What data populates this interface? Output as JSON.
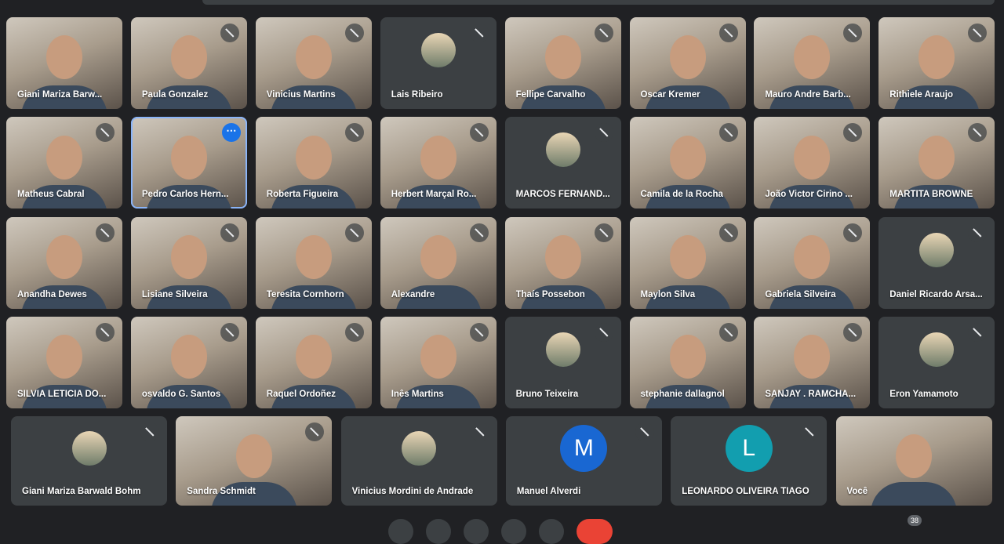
{
  "participants": [
    {
      "name": "Giani Mariza Barw...",
      "type": "video",
      "muted": false
    },
    {
      "name": "Paula Gonzalez",
      "type": "video",
      "muted": true
    },
    {
      "name": "Vinicius Martins",
      "type": "video",
      "muted": true
    },
    {
      "name": "Lais Ribeiro",
      "type": "avatar",
      "muted": true
    },
    {
      "name": "Fellipe Carvalho",
      "type": "video",
      "muted": true
    },
    {
      "name": "Oscar Kremer",
      "type": "video",
      "muted": true
    },
    {
      "name": "Mauro Andre Barb...",
      "type": "video",
      "muted": true
    },
    {
      "name": "Rithiele Araujo",
      "type": "video",
      "muted": true
    },
    {
      "name": "Matheus Cabral",
      "type": "video",
      "muted": true
    },
    {
      "name": "Pedro Carlos Hern...",
      "type": "video",
      "muted": false,
      "selected": true
    },
    {
      "name": "Roberta Figueira",
      "type": "video",
      "muted": true
    },
    {
      "name": "Herbert Marçal Ro...",
      "type": "video",
      "muted": true
    },
    {
      "name": "MARCOS FERNÁND...",
      "type": "avatar",
      "muted": true
    },
    {
      "name": "Camila de la Rocha",
      "type": "video",
      "muted": true
    },
    {
      "name": "João Victor Cirino ...",
      "type": "video",
      "muted": true
    },
    {
      "name": "MARTITA BROWNE",
      "type": "video",
      "muted": true
    },
    {
      "name": "Anandha Dewes",
      "type": "video",
      "muted": true
    },
    {
      "name": "Lisiane Silveira",
      "type": "video",
      "muted": true
    },
    {
      "name": "Teresita Cornhorn",
      "type": "video",
      "muted": true
    },
    {
      "name": "Alexandre",
      "type": "video",
      "muted": true
    },
    {
      "name": "Thaís Possebon",
      "type": "video",
      "muted": true
    },
    {
      "name": "Maylon Silva",
      "type": "video",
      "muted": true
    },
    {
      "name": "Gabriela Silveira",
      "type": "video",
      "muted": true
    },
    {
      "name": "Daniel Ricardo Arsa...",
      "type": "avatar",
      "muted": true
    },
    {
      "name": "SILVIA LETICIA DO...",
      "type": "video",
      "muted": true
    },
    {
      "name": "osvaldo G. Santos",
      "type": "video",
      "muted": true
    },
    {
      "name": "Raquel Ordoñez",
      "type": "video",
      "muted": true
    },
    {
      "name": "Inês Martins",
      "type": "video",
      "muted": true
    },
    {
      "name": "Bruno Teixeira",
      "type": "avatar",
      "muted": true
    },
    {
      "name": "stephanie dallagnol",
      "type": "video",
      "muted": true
    },
    {
      "name": "SANJAY . RAMCHA...",
      "type": "video",
      "muted": true
    },
    {
      "name": "Eron Yamamoto",
      "type": "avatar",
      "muted": true
    }
  ],
  "bottom_row": [
    {
      "name": "Giani Mariza Barwald Bohm",
      "type": "avatar",
      "muted": true
    },
    {
      "name": "Sandra Schmidt",
      "type": "video",
      "muted": true
    },
    {
      "name": "Vinicius Mordini de Andrade",
      "type": "avatar",
      "muted": true
    },
    {
      "name": "Manuel Alverdi",
      "type": "letter",
      "letter": "M",
      "color": "#1967d2",
      "muted": true
    },
    {
      "name": "LEONARDO OLIVEIRA TIAGO",
      "type": "letter",
      "letter": "L",
      "color": "#129eaf",
      "muted": true
    },
    {
      "name": "Você",
      "type": "video",
      "muted": false
    }
  ],
  "more_options_icon": "⋯",
  "participant_count": "38"
}
